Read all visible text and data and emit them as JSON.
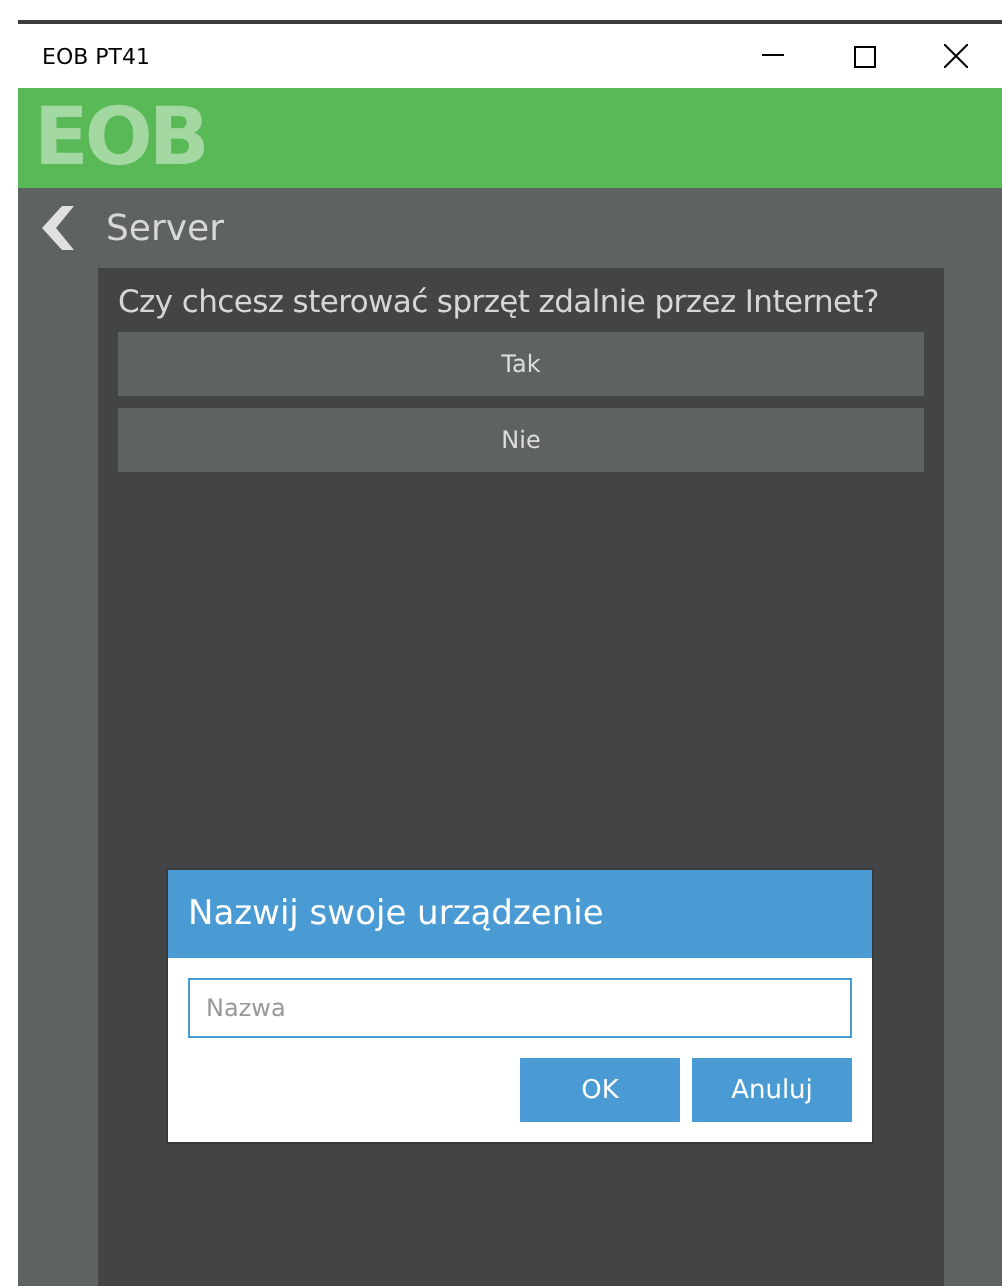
{
  "window": {
    "title": "EOB PT41"
  },
  "header": {
    "logo": "EOB"
  },
  "nav": {
    "title": "Server"
  },
  "question": {
    "text": "Czy chcesz sterować sprzęt zdalnie przez Internet?",
    "options": [
      "Tak",
      "Nie"
    ]
  },
  "dialog": {
    "title": "Nazwij swoje urządzenie",
    "placeholder": "Nazwa",
    "buttons": [
      "OK",
      "Anuluj"
    ]
  }
}
